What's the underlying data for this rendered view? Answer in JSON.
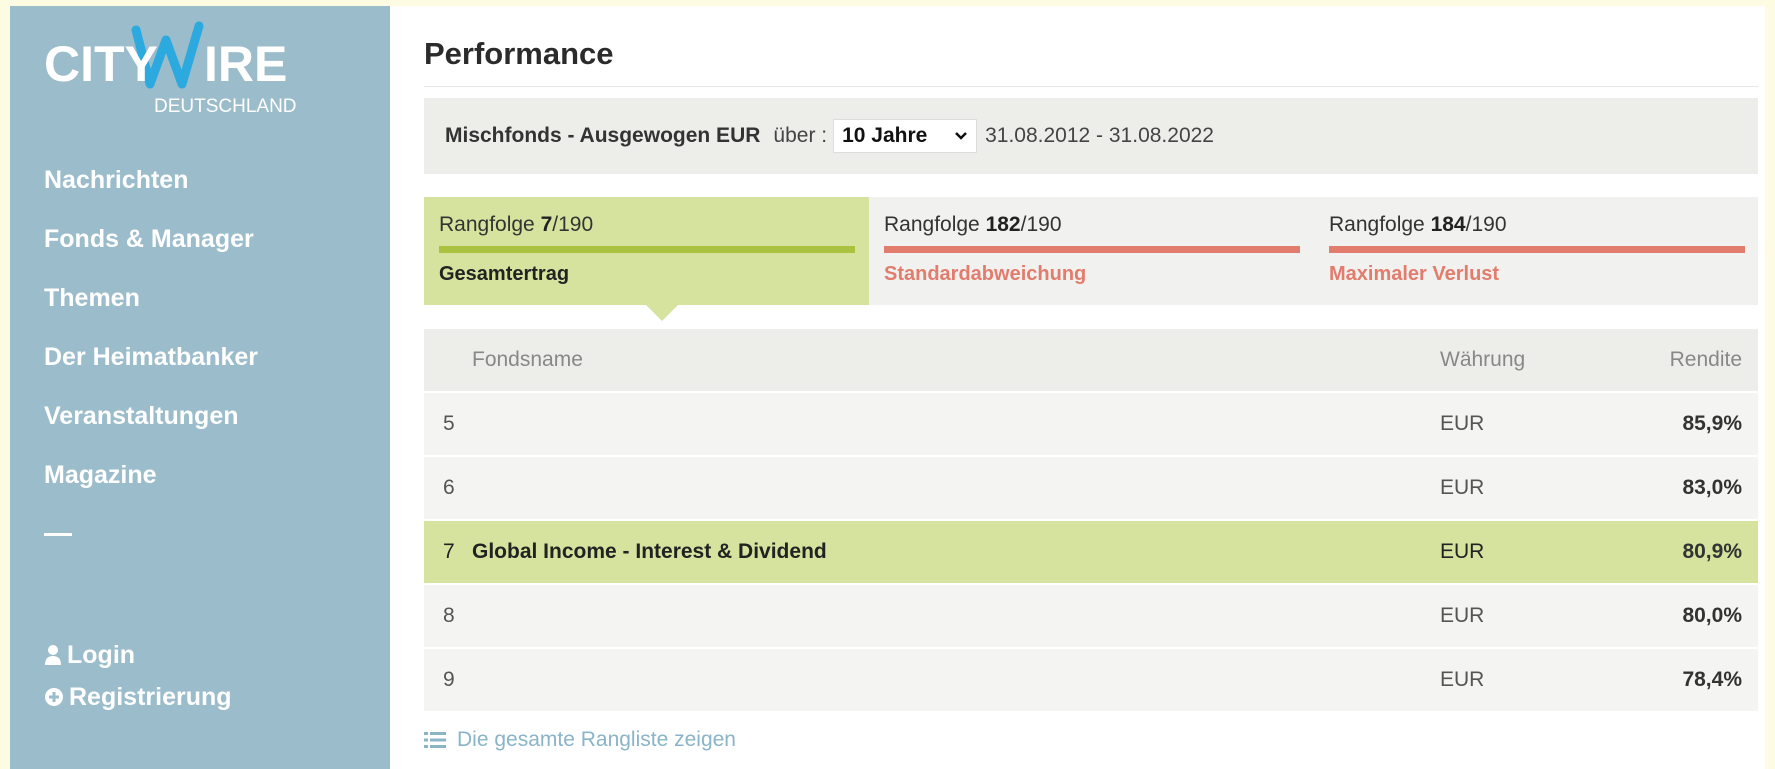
{
  "brand": {
    "logo_text": "CITYWIRE",
    "logo_sub": "DEUTSCHLAND"
  },
  "sidebar": {
    "nav": [
      {
        "label": "Nachrichten"
      },
      {
        "label": "Fonds & Manager"
      },
      {
        "label": "Themen"
      },
      {
        "label": "Der Heimatbanker"
      },
      {
        "label": "Veranstaltungen"
      },
      {
        "label": "Magazine"
      }
    ],
    "login_label": "Login",
    "register_label": "Registrierung"
  },
  "main": {
    "title": "Performance",
    "filter": {
      "category": "Mischfonds - Ausgewogen EUR",
      "over_label": "über :",
      "period": "10 Jahre",
      "dates": "31.08.2012 - 31.08.2022"
    },
    "tabs": [
      {
        "rank_prefix": "Rangfolge ",
        "rank": "7",
        "total": "/190",
        "metric": "Gesamtertrag",
        "active": true,
        "color": "#a9c23f"
      },
      {
        "rank_prefix": "Rangfolge ",
        "rank": "182",
        "total": "/190",
        "metric": "Standardabweichung",
        "active": false,
        "color": "#e27c6c"
      },
      {
        "rank_prefix": "Rangfolge ",
        "rank": "184",
        "total": "/190",
        "metric": "Maximaler Verlust",
        "active": false,
        "color": "#e27c6c"
      }
    ],
    "table": {
      "headers": {
        "name": "Fondsname",
        "currency": "Währung",
        "return": "Rendite"
      },
      "rows": [
        {
          "rank": "5",
          "name": "",
          "currency": "EUR",
          "return": "85,9%"
        },
        {
          "rank": "6",
          "name": "",
          "currency": "EUR",
          "return": "83,0%"
        },
        {
          "rank": "7",
          "name": "Global Income - Interest & Dividend",
          "currency": "EUR",
          "return": "80,9%"
        },
        {
          "rank": "8",
          "name": "",
          "currency": "EUR",
          "return": "80,0%"
        },
        {
          "rank": "9",
          "name": "",
          "currency": "EUR",
          "return": "78,4%"
        }
      ]
    },
    "more_link": "Die gesamte Rangliste zeigen"
  },
  "colors": {
    "sidebar_bg": "#9bbccb",
    "highlight": "#d6e39e",
    "positive_bar": "#a9c23f",
    "negative": "#e27c6c",
    "link": "#8ab4c8"
  }
}
